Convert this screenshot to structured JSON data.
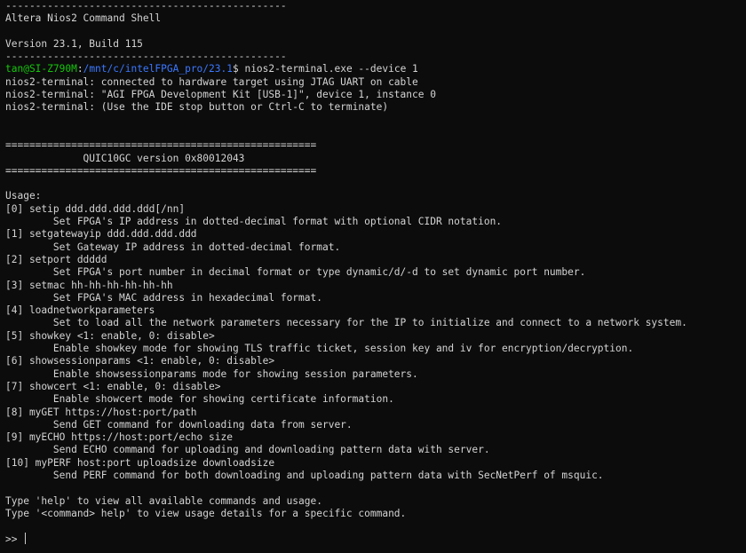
{
  "terminal": {
    "header": {
      "top_rule": "-----------------------------------------------",
      "shell_title": "Altera Nios2 Command Shell",
      "version": "Version 23.1, Build 115",
      "bottom_rule": "-----------------------------------------------"
    },
    "prompt": {
      "user_host": "tan@SI-Z790M",
      "separator": ":",
      "path": "/mnt/c/intelFPGA_pro/23.1",
      "symbol": "$ ",
      "command": "nios2-terminal.exe --device 1"
    },
    "connection_output": [
      "nios2-terminal: connected to hardware target using JTAG UART on cable",
      "nios2-terminal: \"AGI FPGA Development Kit [USB-1]\", device 1, instance 0",
      "nios2-terminal: (Use the IDE stop button or Ctrl-C to terminate)"
    ],
    "banner": {
      "rule": "====================================================",
      "title": "             QUIC10GC version 0x80012043"
    },
    "usage_heading": "Usage:",
    "commands": [
      {
        "syntax": "[0] setip ddd.ddd.ddd.ddd[/nn]",
        "description": "        Set FPGA's IP address in dotted-decimal format with optional CIDR notation."
      },
      {
        "syntax": "[1] setgatewayip ddd.ddd.ddd.ddd",
        "description": "        Set Gateway IP address in dotted-decimal format."
      },
      {
        "syntax": "[2] setport ddddd",
        "description": "        Set FPGA's port number in decimal format or type dynamic/d/-d to set dynamic port number."
      },
      {
        "syntax": "[3] setmac hh-hh-hh-hh-hh-hh",
        "description": "        Set FPGA's MAC address in hexadecimal format."
      },
      {
        "syntax": "[4] loadnetworkparameters",
        "description": "        Set to load all the network parameters necessary for the IP to initialize and connect to a network system."
      },
      {
        "syntax": "[5] showkey <1: enable, 0: disable>",
        "description": "        Enable showkey mode for showing TLS traffic ticket, session key and iv for encryption/decryption."
      },
      {
        "syntax": "[6] showsessionparams <1: enable, 0: disable>",
        "description": "        Enable showsessionparams mode for showing session parameters."
      },
      {
        "syntax": "[7] showcert <1: enable, 0: disable>",
        "description": "        Enable showcert mode for showing certificate information."
      },
      {
        "syntax": "[8] myGET https://host:port/path",
        "description": "        Send GET command for downloading data from server."
      },
      {
        "syntax": "[9] myECHO https://host:port/echo size",
        "description": "        Send ECHO command for uploading and downloading pattern data with server."
      },
      {
        "syntax": "[10] myPERF host:port uploadsize downloadsize",
        "description": "        Send PERF command for both downloading and uploading pattern data with SecNetPerf of msquic."
      }
    ],
    "help_lines": [
      "Type 'help' to view all available commands and usage.",
      "Type '<command> help' to view usage details for a specific command."
    ],
    "input_prompt": ">> "
  }
}
